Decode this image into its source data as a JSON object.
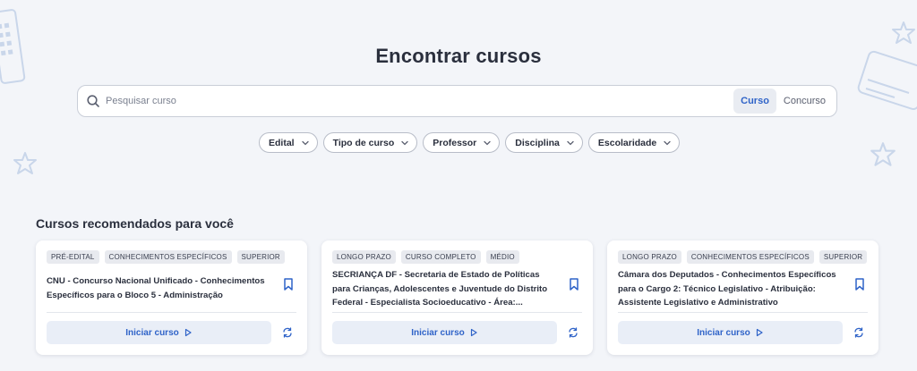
{
  "page": {
    "title": "Encontrar cursos"
  },
  "search": {
    "placeholder": "Pesquisar curso",
    "value": "",
    "toggle": {
      "active": "Curso",
      "inactive": "Concurso"
    },
    "icon": "search-icon"
  },
  "filters": [
    "Edital",
    "Tipo de curso",
    "Professor",
    "Disciplina",
    "Escolaridade"
  ],
  "section": {
    "title": "Cursos recomendados para você"
  },
  "cards": [
    {
      "tags": [
        "PRÉ-EDITAL",
        "CONHECIMENTOS ESPECÍFICOS",
        "SUPERIOR"
      ],
      "title": "CNU - Concurso Nacional Unificado - Conhecimentos Específicos para o Bloco 5 - Administração",
      "button": "Iniciar curso"
    },
    {
      "tags": [
        "LONGO PRAZO",
        "CURSO COMPLETO",
        "MÉDIO"
      ],
      "title": "SECRIANÇA DF - Secretaria de Estado de Políticas para Crianças, Adolescentes e Juventude do Distrito Federal - Especialista Socioeducativo - Área:...",
      "button": "Iniciar curso"
    },
    {
      "tags": [
        "LONGO PRAZO",
        "CONHECIMENTOS ESPECÍFICOS",
        "SUPERIOR"
      ],
      "title": "Câmara dos Deputados - Conhecimentos Específicos para o Cargo 2: Técnico Legislativo - Atribuição: Assistente Legislativo e Administrativo",
      "button": "Iniciar curso"
    }
  ],
  "colors": {
    "accent": "#2f63c8",
    "background": "#f3f5f9",
    "decoration": "#c9d6ea"
  }
}
